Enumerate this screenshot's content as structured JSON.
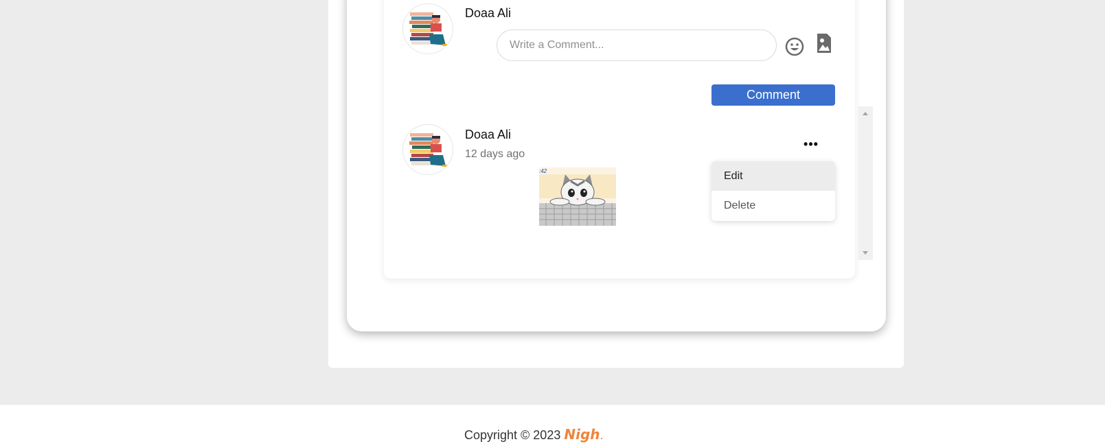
{
  "composer": {
    "author_name": "Doaa Ali",
    "input_placeholder": "Write a Comment...",
    "input_value": "",
    "emoji_icon": "smiley-icon",
    "image_icon": "image-upload-icon",
    "submit_label": "Comment"
  },
  "comment": {
    "author_name": "Doaa Ali",
    "timestamp": "12 days ago",
    "image_icon": "kitten-on-keyboard-image",
    "image_caption": ":42",
    "more_label": "•••"
  },
  "menu": {
    "items": [
      {
        "label": "Edit",
        "highlighted": true
      },
      {
        "label": "Delete",
        "highlighted": false
      }
    ]
  },
  "footer": {
    "copyright": "Copyright © 2023",
    "brand": "Nigh",
    "brand_suffix": "."
  },
  "colors": {
    "accent": "#3b6fce",
    "brand": "#f0843a",
    "background": "#ececec"
  }
}
